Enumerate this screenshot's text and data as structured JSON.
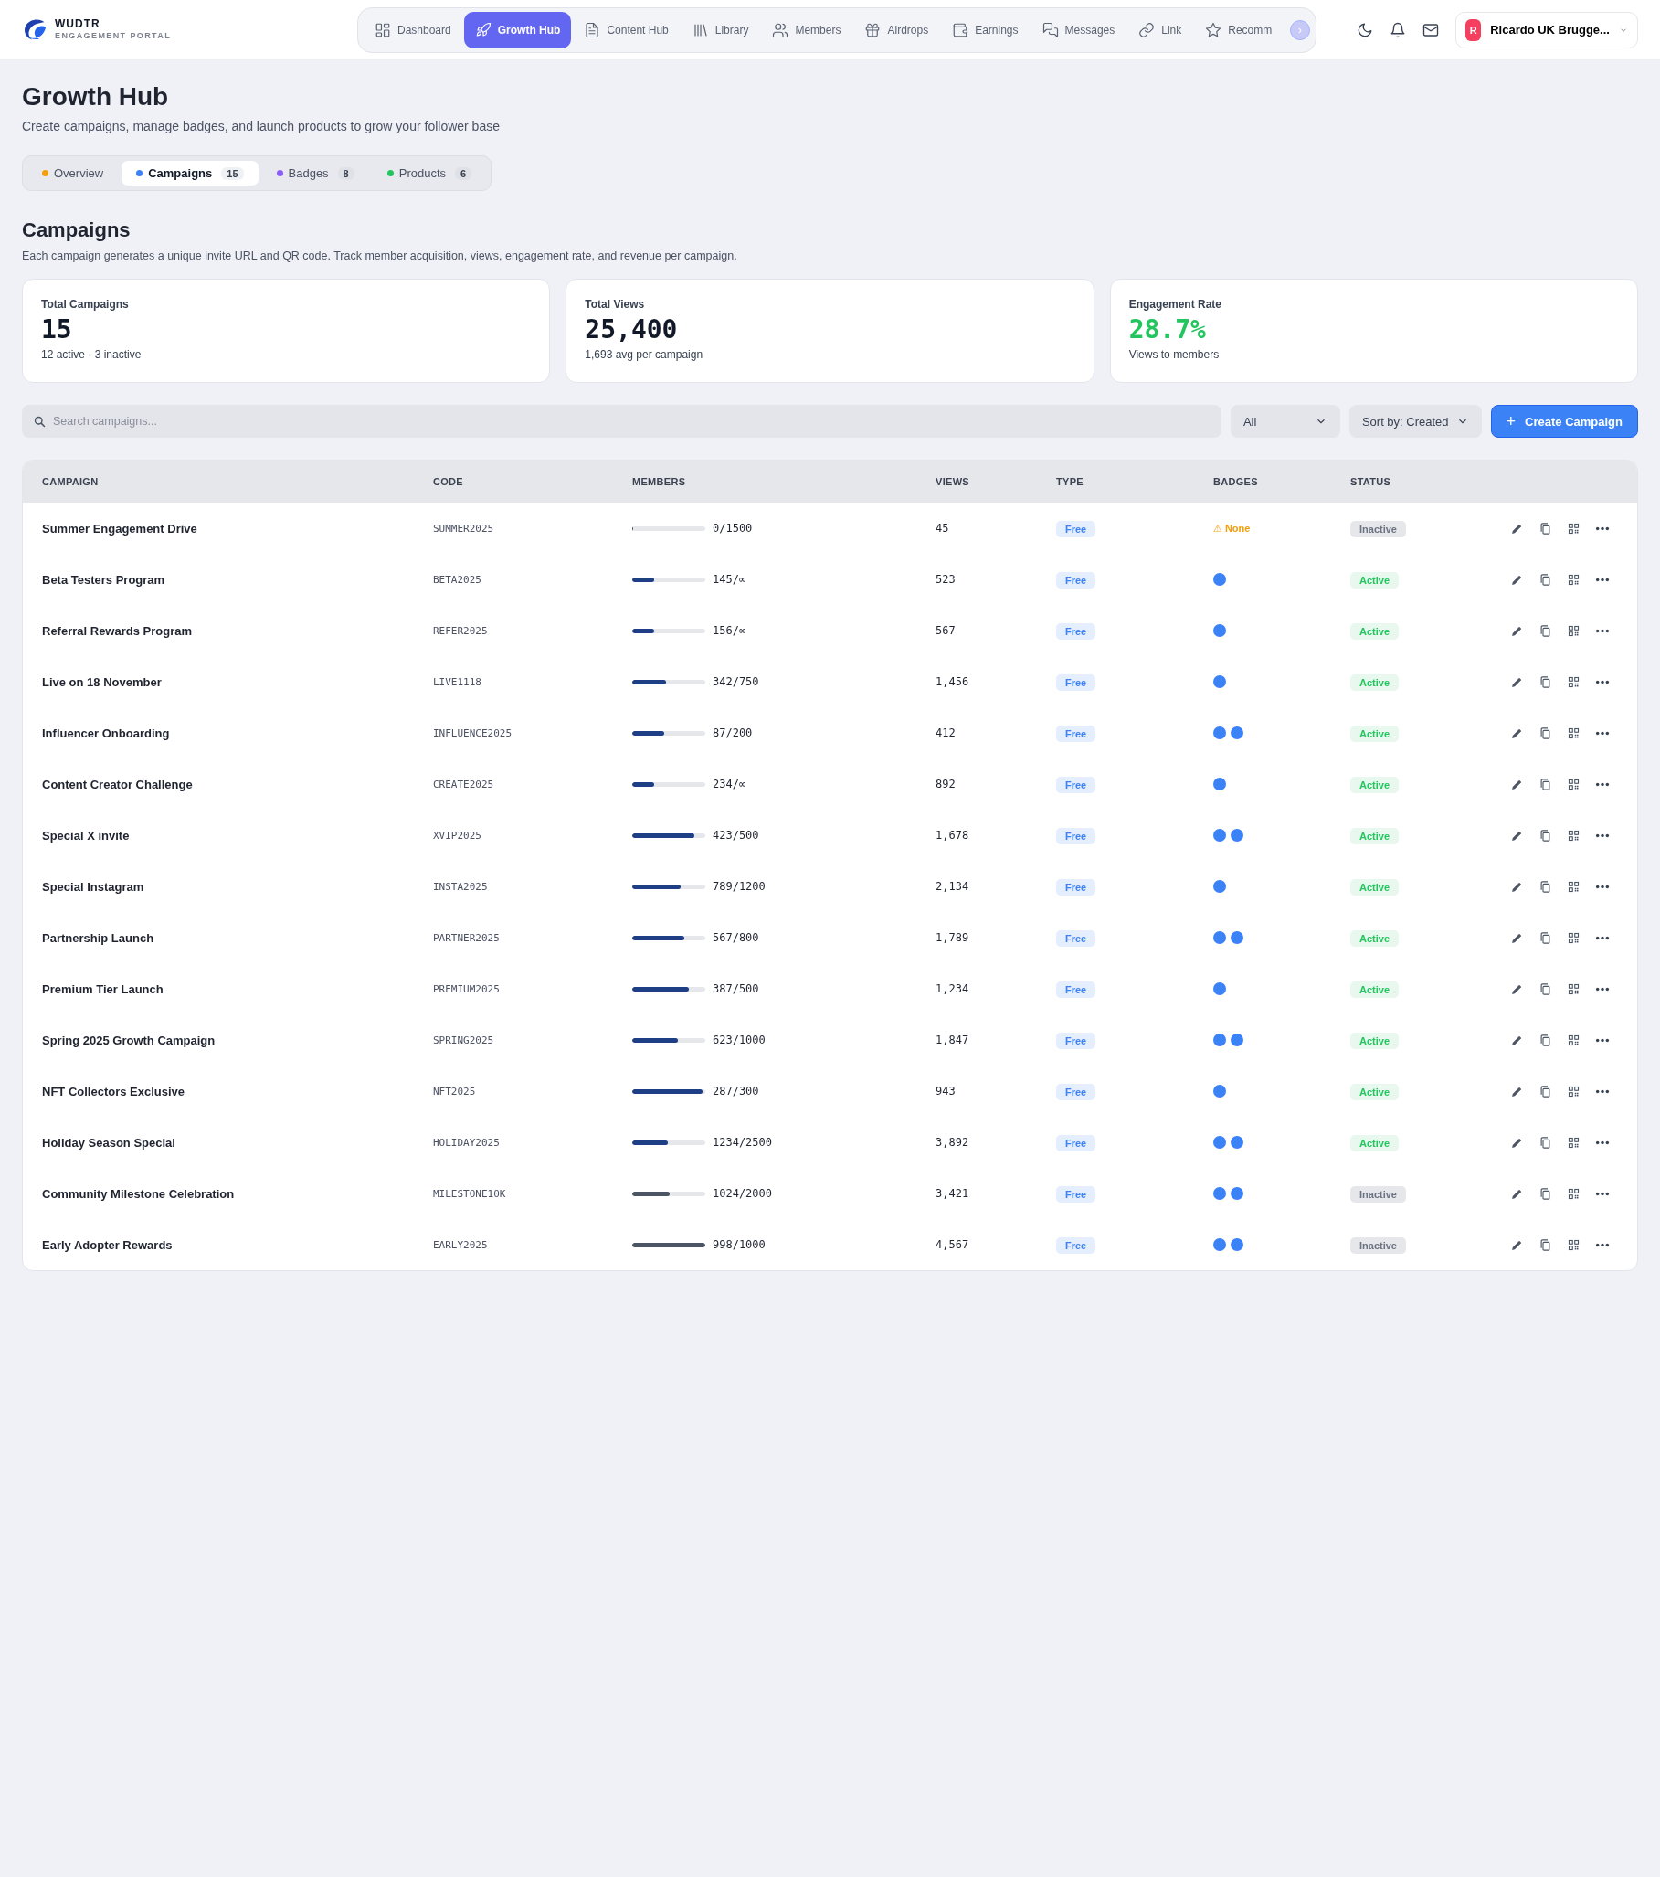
{
  "brand": {
    "name": "WUDTR",
    "tagline": "ENGAGEMENT PORTAL"
  },
  "nav": [
    {
      "label": "Dashboard",
      "selected": false
    },
    {
      "label": "Growth Hub",
      "selected": true
    },
    {
      "label": "Content Hub",
      "selected": false
    },
    {
      "label": "Library",
      "selected": false
    },
    {
      "label": "Members",
      "selected": false
    },
    {
      "label": "Airdrops",
      "selected": false
    },
    {
      "label": "Earnings",
      "selected": false
    },
    {
      "label": "Messages",
      "selected": false
    },
    {
      "label": "Link",
      "selected": false
    },
    {
      "label": "Recomm",
      "selected": false
    }
  ],
  "nav_scroll": "›",
  "user": {
    "initial": "R",
    "name": "Ricardo UK Brugge..."
  },
  "page": {
    "title": "Growth Hub",
    "subtitle": "Create campaigns, manage badges, and launch products to grow your follower base"
  },
  "tabs": [
    {
      "label": "Overview",
      "color": "#f59e0b",
      "selected": false
    },
    {
      "label": "Campaigns",
      "count": "15",
      "color": "#3b82f6",
      "selected": true
    },
    {
      "label": "Badges",
      "count": "8",
      "color": "#8b5cf6",
      "selected": false
    },
    {
      "label": "Products",
      "count": "6",
      "color": "#22c55e",
      "selected": false
    }
  ],
  "section": {
    "title": "Campaigns",
    "description": "Each campaign generates a unique invite URL and QR code. Track member acquisition, views, engagement rate, and revenue per campaign."
  },
  "stats": [
    {
      "label": "Total Campaigns",
      "value": "15",
      "note": "12 active · 3 inactive",
      "highlight": false
    },
    {
      "label": "Total Views",
      "value": "25,400",
      "note": "1,693 avg per campaign",
      "highlight": false
    },
    {
      "label": "Engagement Rate",
      "value": "28.7%",
      "note": "Views to members",
      "highlight": true
    }
  ],
  "search": {
    "placeholder": "Search campaigns..."
  },
  "filter": {
    "value": "All"
  },
  "sort": {
    "value": "Sort by: Created"
  },
  "create_button": {
    "icon": "+",
    "label": "Create Campaign"
  },
  "table": {
    "columns": [
      "CAMPAIGN",
      "CODE",
      "MEMBERS",
      "VIEWS",
      "TYPE",
      "BADGES",
      "STATUS"
    ],
    "rows": [
      {
        "name": "Summer Engagement Drive",
        "code": "SUMMER2025",
        "members": "0/1500",
        "level": 0,
        "views": "45",
        "type": "Free",
        "badges": [],
        "badges_note": "⚠ None",
        "status": "Inactive",
        "active": false
      },
      {
        "name": "Beta Testers Program",
        "code": "BETA2025",
        "members": "145/∞",
        "level": 0.3,
        "views": "523",
        "type": "Free",
        "badges": [
          {
            "color": "#3b82f6"
          }
        ],
        "status": "Active",
        "active": true
      },
      {
        "name": "Referral Rewards Program",
        "code": "REFER2025",
        "members": "156/∞",
        "level": 0.3,
        "views": "567",
        "type": "Free",
        "badges": [
          {
            "color": "#3b82f6"
          }
        ],
        "status": "Active",
        "active": true
      },
      {
        "name": "Live on 18 November",
        "code": "LIVE1118",
        "members": "342/750",
        "level": 0.46,
        "views": "1,456",
        "type": "Free",
        "badges": [
          {
            "color": "#3b82f6"
          }
        ],
        "status": "Active",
        "active": true
      },
      {
        "name": "Influencer Onboarding",
        "code": "INFLUENCE2025",
        "members": "87/200",
        "level": 0.44,
        "views": "412",
        "type": "Free",
        "badges": [
          {
            "color": "#3b82f6"
          },
          {
            "color": "#3b82f6"
          }
        ],
        "status": "Active",
        "active": true
      },
      {
        "name": "Content Creator Challenge",
        "code": "CREATE2025",
        "members": "234/∞",
        "level": 0.3,
        "views": "892",
        "type": "Free",
        "badges": [
          {
            "color": "#3b82f6"
          }
        ],
        "status": "Active",
        "active": true
      },
      {
        "name": "Special X invite",
        "code": "XVIP2025",
        "members": "423/500",
        "level": 0.85,
        "views": "1,678",
        "type": "Free",
        "badges": [
          {
            "color": "#3b82f6"
          },
          {
            "color": "#3b82f6"
          }
        ],
        "status": "Active",
        "active": true
      },
      {
        "name": "Special Instagram",
        "code": "INSTA2025",
        "members": "789/1200",
        "level": 0.66,
        "views": "2,134",
        "type": "Free",
        "badges": [
          {
            "color": "#3b82f6"
          }
        ],
        "status": "Active",
        "active": true
      },
      {
        "name": "Partnership Launch",
        "code": "PARTNER2025",
        "members": "567/800",
        "level": 0.71,
        "views": "1,789",
        "type": "Free",
        "badges": [
          {
            "color": "#3b82f6"
          },
          {
            "color": "#3b82f6"
          }
        ],
        "status": "Active",
        "active": true
      },
      {
        "name": "Premium Tier Launch",
        "code": "PREMIUM2025",
        "members": "387/500",
        "level": 0.77,
        "views": "1,234",
        "type": "Free",
        "badges": [
          {
            "color": "#3b82f6"
          }
        ],
        "status": "Active",
        "active": true
      },
      {
        "name": "Spring 2025 Growth Campaign",
        "code": "SPRING2025",
        "members": "623/1000",
        "level": 0.62,
        "views": "1,847",
        "type": "Free",
        "badges": [
          {
            "color": "#3b82f6"
          },
          {
            "color": "#3b82f6"
          }
        ],
        "status": "Active",
        "active": true
      },
      {
        "name": "NFT Collectors Exclusive",
        "code": "NFT2025",
        "members": "287/300",
        "level": 0.96,
        "views": "943",
        "type": "Free",
        "badges": [
          {
            "color": "#3b82f6"
          }
        ],
        "status": "Active",
        "active": true
      },
      {
        "name": "Holiday Season Special",
        "code": "HOLIDAY2025",
        "members": "1234/2500",
        "level": 0.49,
        "views": "3,892",
        "type": "Free",
        "badges": [
          {
            "color": "#3b82f6"
          },
          {
            "color": "#3b82f6"
          }
        ],
        "status": "Active",
        "active": true
      },
      {
        "name": "Community Milestone Celebration",
        "code": "MILESTONE10K",
        "members": "1024/2000",
        "level": 0.51,
        "views": "3,421",
        "type": "Free",
        "badges": [
          {
            "color": "#3b82f6"
          },
          {
            "color": "#3b82f6"
          }
        ],
        "status": "Inactive",
        "active": false
      },
      {
        "name": "Early Adopter Rewards",
        "code": "EARLY2025",
        "members": "998/1000",
        "level": 1.0,
        "views": "4,567",
        "type": "Free",
        "badges": [
          {
            "color": "#3b82f6"
          },
          {
            "color": "#3b82f6"
          }
        ],
        "status": "Inactive",
        "active": false
      }
    ]
  }
}
